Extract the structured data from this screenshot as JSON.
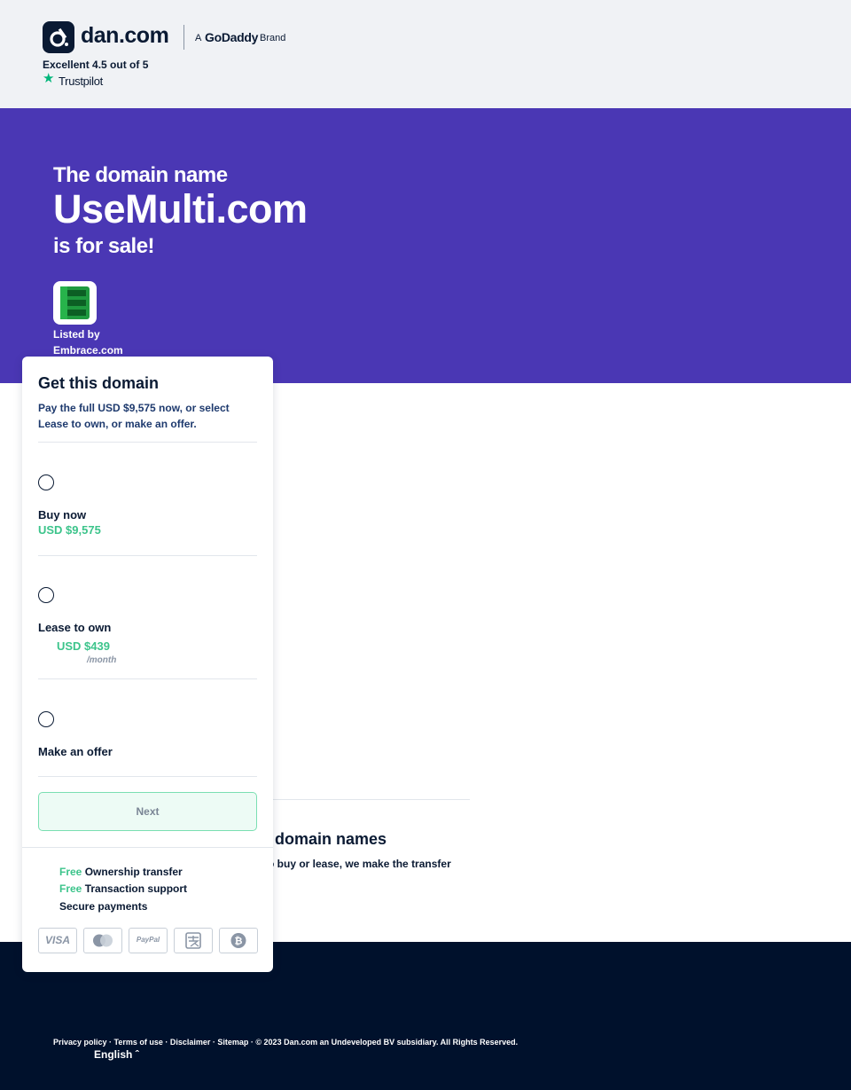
{
  "header": {
    "logo_text": "dan.com",
    "brand_prefix": "A",
    "brand_name": "GoDaddy",
    "brand_suffix": "Brand",
    "rating_text": "Excellent 4.5 out of 5",
    "trustpilot_label": "Trustpilot",
    "trustpilot_star": "★"
  },
  "hero": {
    "line1": "The domain name",
    "domain": "UseMulti.com",
    "line3": "is for sale!",
    "listed_by_label": "Listed by",
    "seller": "Embrace.com"
  },
  "card": {
    "title": "Get this domain",
    "subtitle": "Pay the full USD $9,575 now, or select Lease to own, or make an offer.",
    "options": [
      {
        "label": "Buy now",
        "price": "USD $9,575"
      },
      {
        "label": "Lease to own",
        "price": "USD $439",
        "per": "/month"
      },
      {
        "label": "Make an offer"
      }
    ],
    "next_label": "Next",
    "features": [
      {
        "free": "Free",
        "text": "Ownership transfer"
      },
      {
        "free": "Free",
        "text": "Transaction support"
      },
      {
        "free": "",
        "text": "Secure payments"
      }
    ],
    "payment_methods": [
      "VISA",
      "mastercard-icon",
      "PayPal",
      "alipay-icon",
      "bitcoin-icon"
    ]
  },
  "trust": {
    "title": "domain names",
    "text": "o buy or lease, we make the transfer"
  },
  "footer": {
    "links": "Privacy policy · Terms of use · Disclaimer · Sitemap · © 2023 Dan.com an Undeveloped BV subsidiary. All Rights Reserved.",
    "language": "English ˆ"
  },
  "colors": {
    "hero_bg": "#4a37b4",
    "accent_green": "#3cc48b",
    "footer_bg": "#00112c",
    "header_bg": "#f0f2f5"
  }
}
